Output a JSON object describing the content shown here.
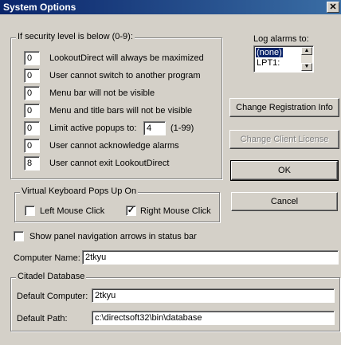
{
  "window": {
    "title": "System Options",
    "close": "✕"
  },
  "security": {
    "legend": "If security level is below (0-9):",
    "rows": [
      {
        "value": "0",
        "label": "LookoutDirect will always be maximized"
      },
      {
        "value": "0",
        "label": "User cannot switch to another program"
      },
      {
        "value": "0",
        "label": "Menu bar will not be visible"
      },
      {
        "value": "0",
        "label": "Menu and title bars will not be visible"
      },
      {
        "value": "0",
        "label": "Limit active popups to:"
      },
      {
        "value": "0",
        "label": "User cannot acknowledge alarms"
      },
      {
        "value": "8",
        "label": "User cannot exit LookoutDirect"
      }
    ],
    "popups_value": "4",
    "popups_range": "(1-99)"
  },
  "log_alarms": {
    "label": "Log alarms to:",
    "options": [
      "(none)",
      "LPT1:"
    ],
    "selected": "(none)"
  },
  "buttons": {
    "change_registration": "Change Registration Info",
    "change_client": "Change Client License",
    "ok": "OK",
    "cancel": "Cancel"
  },
  "keyboard": {
    "legend": "Virtual Keyboard Pops Up On",
    "left_label": "Left Mouse Click",
    "left_checked": false,
    "right_label": "Right Mouse Click",
    "right_checked": true
  },
  "nav_arrows": {
    "label": "Show panel navigation arrows in status bar",
    "checked": false
  },
  "computer_name": {
    "label": "Computer Name:",
    "value": "2tkyu"
  },
  "citadel": {
    "legend": "Citadel Database",
    "default_computer_label": "Default Computer:",
    "default_computer_value": "2tkyu",
    "default_path_label": "Default Path:",
    "default_path_value": "c:\\directsoft32\\bin\\database"
  },
  "glyphs": {
    "check": "✓",
    "up": "▲",
    "down": "▼"
  }
}
